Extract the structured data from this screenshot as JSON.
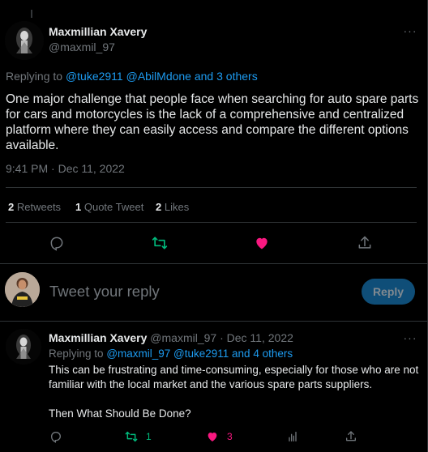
{
  "main_tweet": {
    "author_name": "Maxmillian Xavery",
    "author_handle": "@maxmil_97",
    "more_label": "···",
    "replying_prefix": "Replying to",
    "replying_to": "@tuke2911 @AbilMdone and 3 others",
    "text": "One major challenge that people face when searching for auto spare parts for cars and motorcycles is the lack of a comprehensive and centralized platform where they can easily access and compare the different options available.",
    "timestamp": "9:41 PM · Dec 11, 2022",
    "stats": {
      "retweets_count": "2",
      "retweets_label": "Retweets",
      "quotes_count": "1",
      "quotes_label": "Quote Tweet",
      "likes_count": "2",
      "likes_label": "Likes"
    },
    "actions": [
      "reply-icon",
      "retweet-icon",
      "like-icon",
      "share-icon"
    ],
    "colors": {
      "retweet": "#00ba7c",
      "like": "#f91880",
      "link": "#1d9bf0",
      "muted": "#71767b"
    }
  },
  "reply_box": {
    "placeholder": "Tweet your reply",
    "button_label": "Reply",
    "button_color": "#0f4e78"
  },
  "reply_tweet": {
    "author_name": "Maxmillian Xavery",
    "author_handle": "@maxmil_97",
    "date": "· Dec 11, 2022",
    "more_label": "···",
    "replying_prefix": "Replying to",
    "replying_to": "@maxmil_97 @tuke2911 and 4 others",
    "paragraph_1": "This can be frustrating and time-consuming, especially for those who are not familiar with the local market and the various spare parts suppliers.",
    "paragraph_2": "Then What Should Be Done?",
    "retweet_count": "1",
    "like_count": "3"
  }
}
